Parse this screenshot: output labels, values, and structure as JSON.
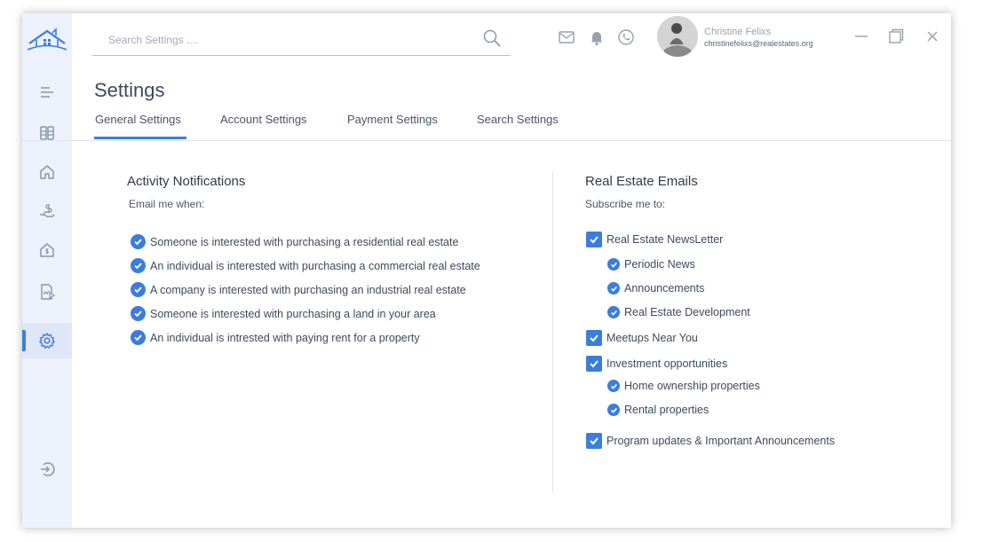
{
  "search": {
    "placeholder": "Search Settings ...."
  },
  "user": {
    "name": "Christine Felixs",
    "email": "christinefelixs@realestates.org"
  },
  "page": {
    "title": "Settings"
  },
  "tabs": [
    {
      "label": "General Settings",
      "active": true
    },
    {
      "label": "Account Settings",
      "active": false
    },
    {
      "label": "Payment Settings",
      "active": false
    },
    {
      "label": "Search Settings",
      "active": false
    }
  ],
  "activity": {
    "title": "Activity Notifications",
    "subtitle": "Email me when:",
    "items": [
      {
        "label": "Someone is interested with purchasing a residential real estate",
        "checked": true
      },
      {
        "label": "An individual is interested with purchasing a commercial real estate",
        "checked": true
      },
      {
        "label": "A company is interested with purchasing an industrial real estate",
        "checked": true
      },
      {
        "label": "Someone is interested with purchasing a land in your area",
        "checked": true
      },
      {
        "label": "An individual is intrested with paying rent for a property",
        "checked": true
      }
    ]
  },
  "emails": {
    "title": "Real Estate Emails",
    "subtitle": "Subscribe me to:",
    "items": [
      {
        "label": "Real Estate NewsLetter",
        "checked": true
      },
      {
        "label": "Periodic News",
        "checked": true
      },
      {
        "label": "Announcements",
        "checked": true
      },
      {
        "label": "Real Estate Development",
        "checked": true
      },
      {
        "label": "Meetups Near You",
        "checked": true
      },
      {
        "label": "Investment opportunities",
        "checked": true
      },
      {
        "label": "Home ownership properties",
        "checked": true
      },
      {
        "label": "Rental properties",
        "checked": true
      },
      {
        "label": "Program updates & Important Announcements",
        "checked": true
      }
    ]
  },
  "sidebar": {
    "items": [
      {
        "icon": "menu-icon",
        "active": false
      },
      {
        "icon": "dashboard-icon",
        "active": false
      },
      {
        "icon": "home-icon",
        "active": false
      },
      {
        "icon": "hand-money-icon",
        "active": false
      },
      {
        "icon": "house-dollar-icon",
        "active": false
      },
      {
        "icon": "report-icon",
        "active": false
      },
      {
        "icon": "gear-icon",
        "active": true
      },
      {
        "icon": "logout-icon",
        "active": false
      }
    ]
  },
  "colors": {
    "accent": "#3b7ddd",
    "sidebar_bg": "#edf1fb",
    "text": "#3d4a5c"
  }
}
